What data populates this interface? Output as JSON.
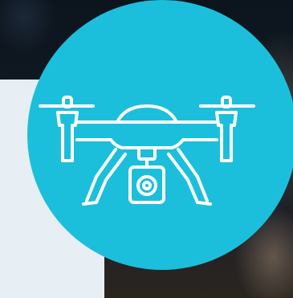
{
  "hero": {
    "icon": "drone-with-camera-icon",
    "colors": {
      "circle": "#1cbfdb",
      "panel": "#e7eff4",
      "icon_stroke": "#ffffff",
      "background": "#0c141d"
    }
  }
}
